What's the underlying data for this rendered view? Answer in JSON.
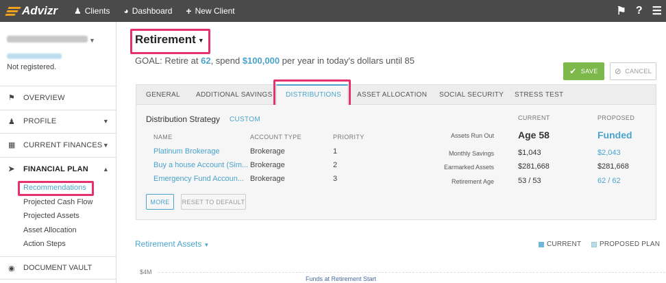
{
  "topbar": {
    "logo_text": "Advizr",
    "nav": [
      {
        "label": "Clients",
        "icon": "users-icon"
      },
      {
        "label": "Dashboard",
        "icon": "dashboard-icon"
      },
      {
        "label": "New Client",
        "icon": "plus-icon"
      }
    ],
    "right_icons": [
      "flag-icon",
      "help-icon",
      "menu-icon"
    ]
  },
  "sidebar": {
    "user_status": "Not registered.",
    "items": [
      {
        "label": "OVERVIEW",
        "icon": "flag-icon"
      },
      {
        "label": "PROFILE",
        "icon": "user-icon"
      },
      {
        "label": "CURRENT FINANCES",
        "icon": "bar-chart-icon"
      },
      {
        "label": "FINANCIAL PLAN",
        "icon": "arrow-icon"
      }
    ],
    "subitems": [
      {
        "label": "Recommendations"
      },
      {
        "label": "Projected Cash Flow"
      },
      {
        "label": "Projected Assets"
      },
      {
        "label": "Asset Allocation"
      },
      {
        "label": "Action Steps"
      }
    ],
    "vault": {
      "label": "DOCUMENT VAULT",
      "icon": "vault-icon"
    }
  },
  "main": {
    "title": "Retirement",
    "goal": {
      "prefix": "GOAL: Retire at ",
      "age": "62",
      "mid": ", spend ",
      "amount": "$100,000",
      "suffix": " per year in today's dollars until 85"
    },
    "save_label": "SAVE",
    "cancel_label": "CANCEL",
    "tabs": [
      {
        "label": "GENERAL"
      },
      {
        "label": "ADDITIONAL SAVINGS"
      },
      {
        "label": "DISTRIBUTIONS"
      },
      {
        "label": "ASSET ALLOCATION"
      },
      {
        "label": "SOCIAL SECURITY"
      },
      {
        "label": "STRESS TEST"
      }
    ],
    "distribution": {
      "title": "Distribution Strategy",
      "mode": "CUSTOM",
      "columns": [
        "NAME",
        "ACCOUNT TYPE",
        "PRIORITY"
      ],
      "rows": [
        {
          "name": "Platinum Brokerage",
          "type": "Brokerage",
          "priority": "1"
        },
        {
          "name": "Buy a house Account (Sim...",
          "type": "Brokerage",
          "priority": "2"
        },
        {
          "name": "Emergency Fund Accoun...",
          "type": "Brokerage",
          "priority": "3"
        }
      ],
      "more_label": "MORE",
      "reset_label": "RESET TO DEFAULT"
    },
    "metrics": {
      "current_header": "CURRENT",
      "proposed_header": "PROPOSED",
      "rows": [
        {
          "label": "Assets Run Out",
          "current": "Age 58",
          "proposed": "Funded"
        },
        {
          "label": "Monthly Savings",
          "current": "$1,043",
          "proposed": "$2,043"
        },
        {
          "label": "Earmarked Assets",
          "current": "$281,668",
          "proposed": "$281,668"
        },
        {
          "label": "Retirement Age",
          "current": "53 / 53",
          "proposed": "62 / 62"
        }
      ]
    },
    "chart": {
      "title": "Retirement Assets",
      "legend": [
        {
          "label": "CURRENT",
          "color": "#6fb6d8"
        },
        {
          "label": "PROPOSED PLAN",
          "color": "#b8dcec"
        }
      ],
      "y_tick": "$4M",
      "annotation": "Funds at Retirement Start"
    }
  }
}
